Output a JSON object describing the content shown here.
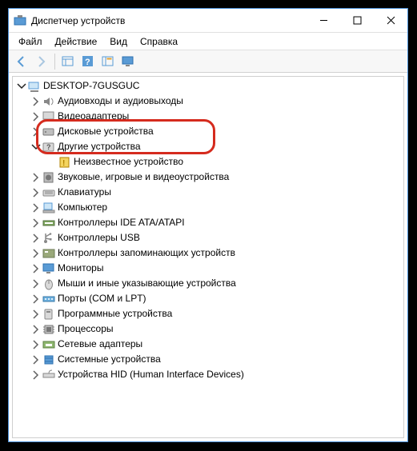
{
  "window": {
    "title": "Диспетчер устройств"
  },
  "menu": {
    "file": "Файл",
    "action": "Действие",
    "view": "Вид",
    "help": "Справка"
  },
  "toolbar": {
    "back": "back",
    "forward": "forward",
    "console": "console",
    "help": "help",
    "details": "details",
    "monitor": "monitor"
  },
  "tree": {
    "root": "DESKTOP-7GUSGUC",
    "items": [
      {
        "label": "Аудиовходы и аудиовыходы",
        "icon": "speaker-icon",
        "level": 1,
        "collapsed": true
      },
      {
        "label": "Видеоадаптеры",
        "icon": "display-adapter-icon",
        "level": 1,
        "collapsed": true
      },
      {
        "label": "Дисковые устройства",
        "icon": "disk-icon",
        "level": 1,
        "collapsed": true,
        "cut": true
      },
      {
        "label": "Другие устройства",
        "icon": "question-device-icon",
        "level": 1,
        "expanded": true
      },
      {
        "label": "Неизвестное устройство",
        "icon": "unknown-device-icon",
        "level": 2
      },
      {
        "label": "Звуковые, игровые и видеоустройства",
        "icon": "sound-icon",
        "level": 1,
        "collapsed": true
      },
      {
        "label": "Клавиатуры",
        "icon": "keyboard-icon",
        "level": 1,
        "collapsed": true
      },
      {
        "label": "Компьютер",
        "icon": "computer-icon",
        "level": 1,
        "collapsed": true
      },
      {
        "label": "Контроллеры IDE ATA/ATAPI",
        "icon": "ide-icon",
        "level": 1,
        "collapsed": true
      },
      {
        "label": "Контроллеры USB",
        "icon": "usb-icon",
        "level": 1,
        "collapsed": true
      },
      {
        "label": "Контроллеры запоминающих устройств",
        "icon": "storage-controller-icon",
        "level": 1,
        "collapsed": true
      },
      {
        "label": "Мониторы",
        "icon": "monitor-device-icon",
        "level": 1,
        "collapsed": true
      },
      {
        "label": "Мыши и иные указывающие устройства",
        "icon": "mouse-icon",
        "level": 1,
        "collapsed": true
      },
      {
        "label": "Порты (COM и LPT)",
        "icon": "port-icon",
        "level": 1,
        "collapsed": true
      },
      {
        "label": "Программные устройства",
        "icon": "software-device-icon",
        "level": 1,
        "collapsed": true
      },
      {
        "label": "Процессоры",
        "icon": "processor-icon",
        "level": 1,
        "collapsed": true
      },
      {
        "label": "Сетевые адаптеры",
        "icon": "network-icon",
        "level": 1,
        "collapsed": true
      },
      {
        "label": "Системные устройства",
        "icon": "system-device-icon",
        "level": 1,
        "collapsed": true
      },
      {
        "label": "Устройства HID (Human Interface Devices)",
        "icon": "hid-icon",
        "level": 1,
        "collapsed": true
      }
    ]
  },
  "highlight_color": "#d52b1e"
}
